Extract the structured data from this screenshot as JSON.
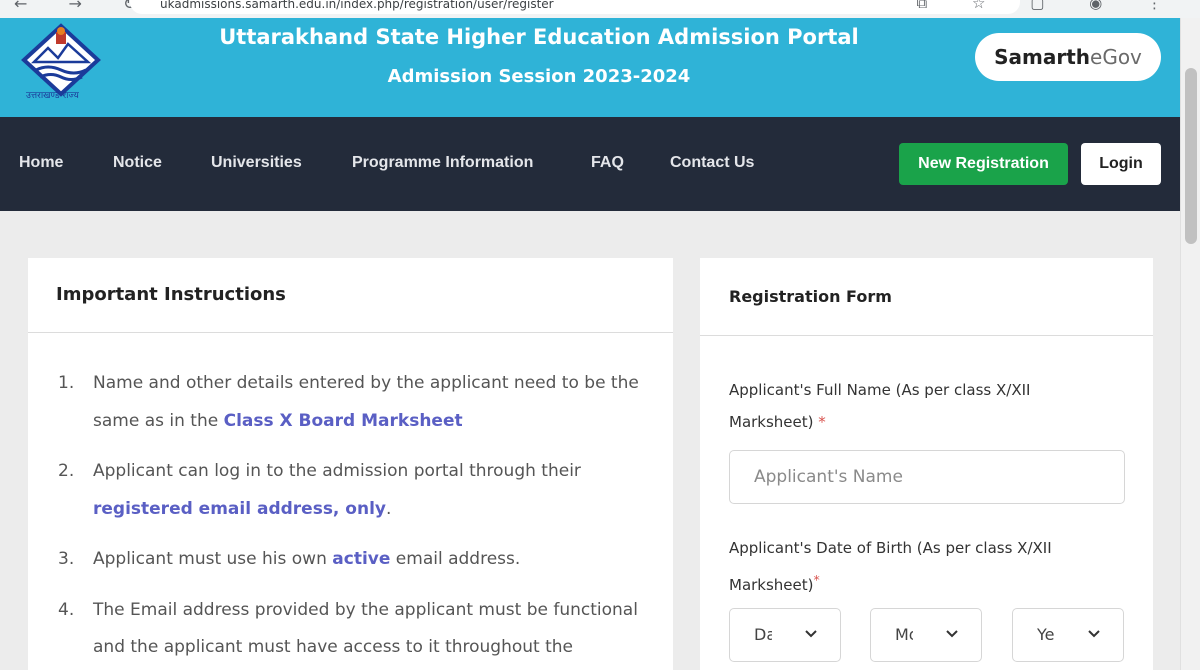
{
  "browser": {
    "url": "ukadmissions.samarth.edu.in/index.php/registration/user/register",
    "nav_glyphs": "← → ↻",
    "tool_glyphs": "⧉ ☆ ▢ ◉ ⋮"
  },
  "header": {
    "logo_caption": "उत्तराखण्ड राज्य",
    "title": "Uttarakhand State Higher Education Admission Portal",
    "subtitle": "Admission Session 2023-2024",
    "brand_primary": "Samarth",
    "brand_secondary": "eGov"
  },
  "nav": {
    "items": [
      "Home",
      "Notice",
      "Universities",
      "Programme Information",
      "FAQ",
      "Contact Us"
    ],
    "register_label": "New Registration",
    "login_label": "Login"
  },
  "instructions": {
    "title": "Important Instructions",
    "items": [
      {
        "num": "1.",
        "pre": "Name and other details entered by the applicant need to be the same as in the ",
        "hl": "Class X Board Marksheet",
        "post": ""
      },
      {
        "num": "2.",
        "pre": "Applicant can log in to the admission portal through their ",
        "hl": "registered email address, only",
        "post": "."
      },
      {
        "num": "3.",
        "pre": "Applicant must use his own ",
        "hl": "active",
        "post": " email address."
      },
      {
        "num": "4.",
        "pre": "The Email address provided by the applicant must be functional and the applicant must have access to it throughout the",
        "hl": "",
        "post": ""
      }
    ]
  },
  "form": {
    "title": "Registration Form",
    "name_label": "Applicant's Full Name (As per class X/XII Marksheet)",
    "name_placeholder": "Applicant's Name",
    "dob_label": "Applicant's Date of Birth (As per class X/XII Marksheet)",
    "required_mark": "*",
    "dob_day": "Day",
    "dob_month": "Month",
    "dob_year": "Year"
  },
  "colors": {
    "header_bg": "#2fb3d7",
    "nav_bg": "#232b3a",
    "register_bg": "#1aa34a",
    "highlight": "#5a5fc4"
  }
}
